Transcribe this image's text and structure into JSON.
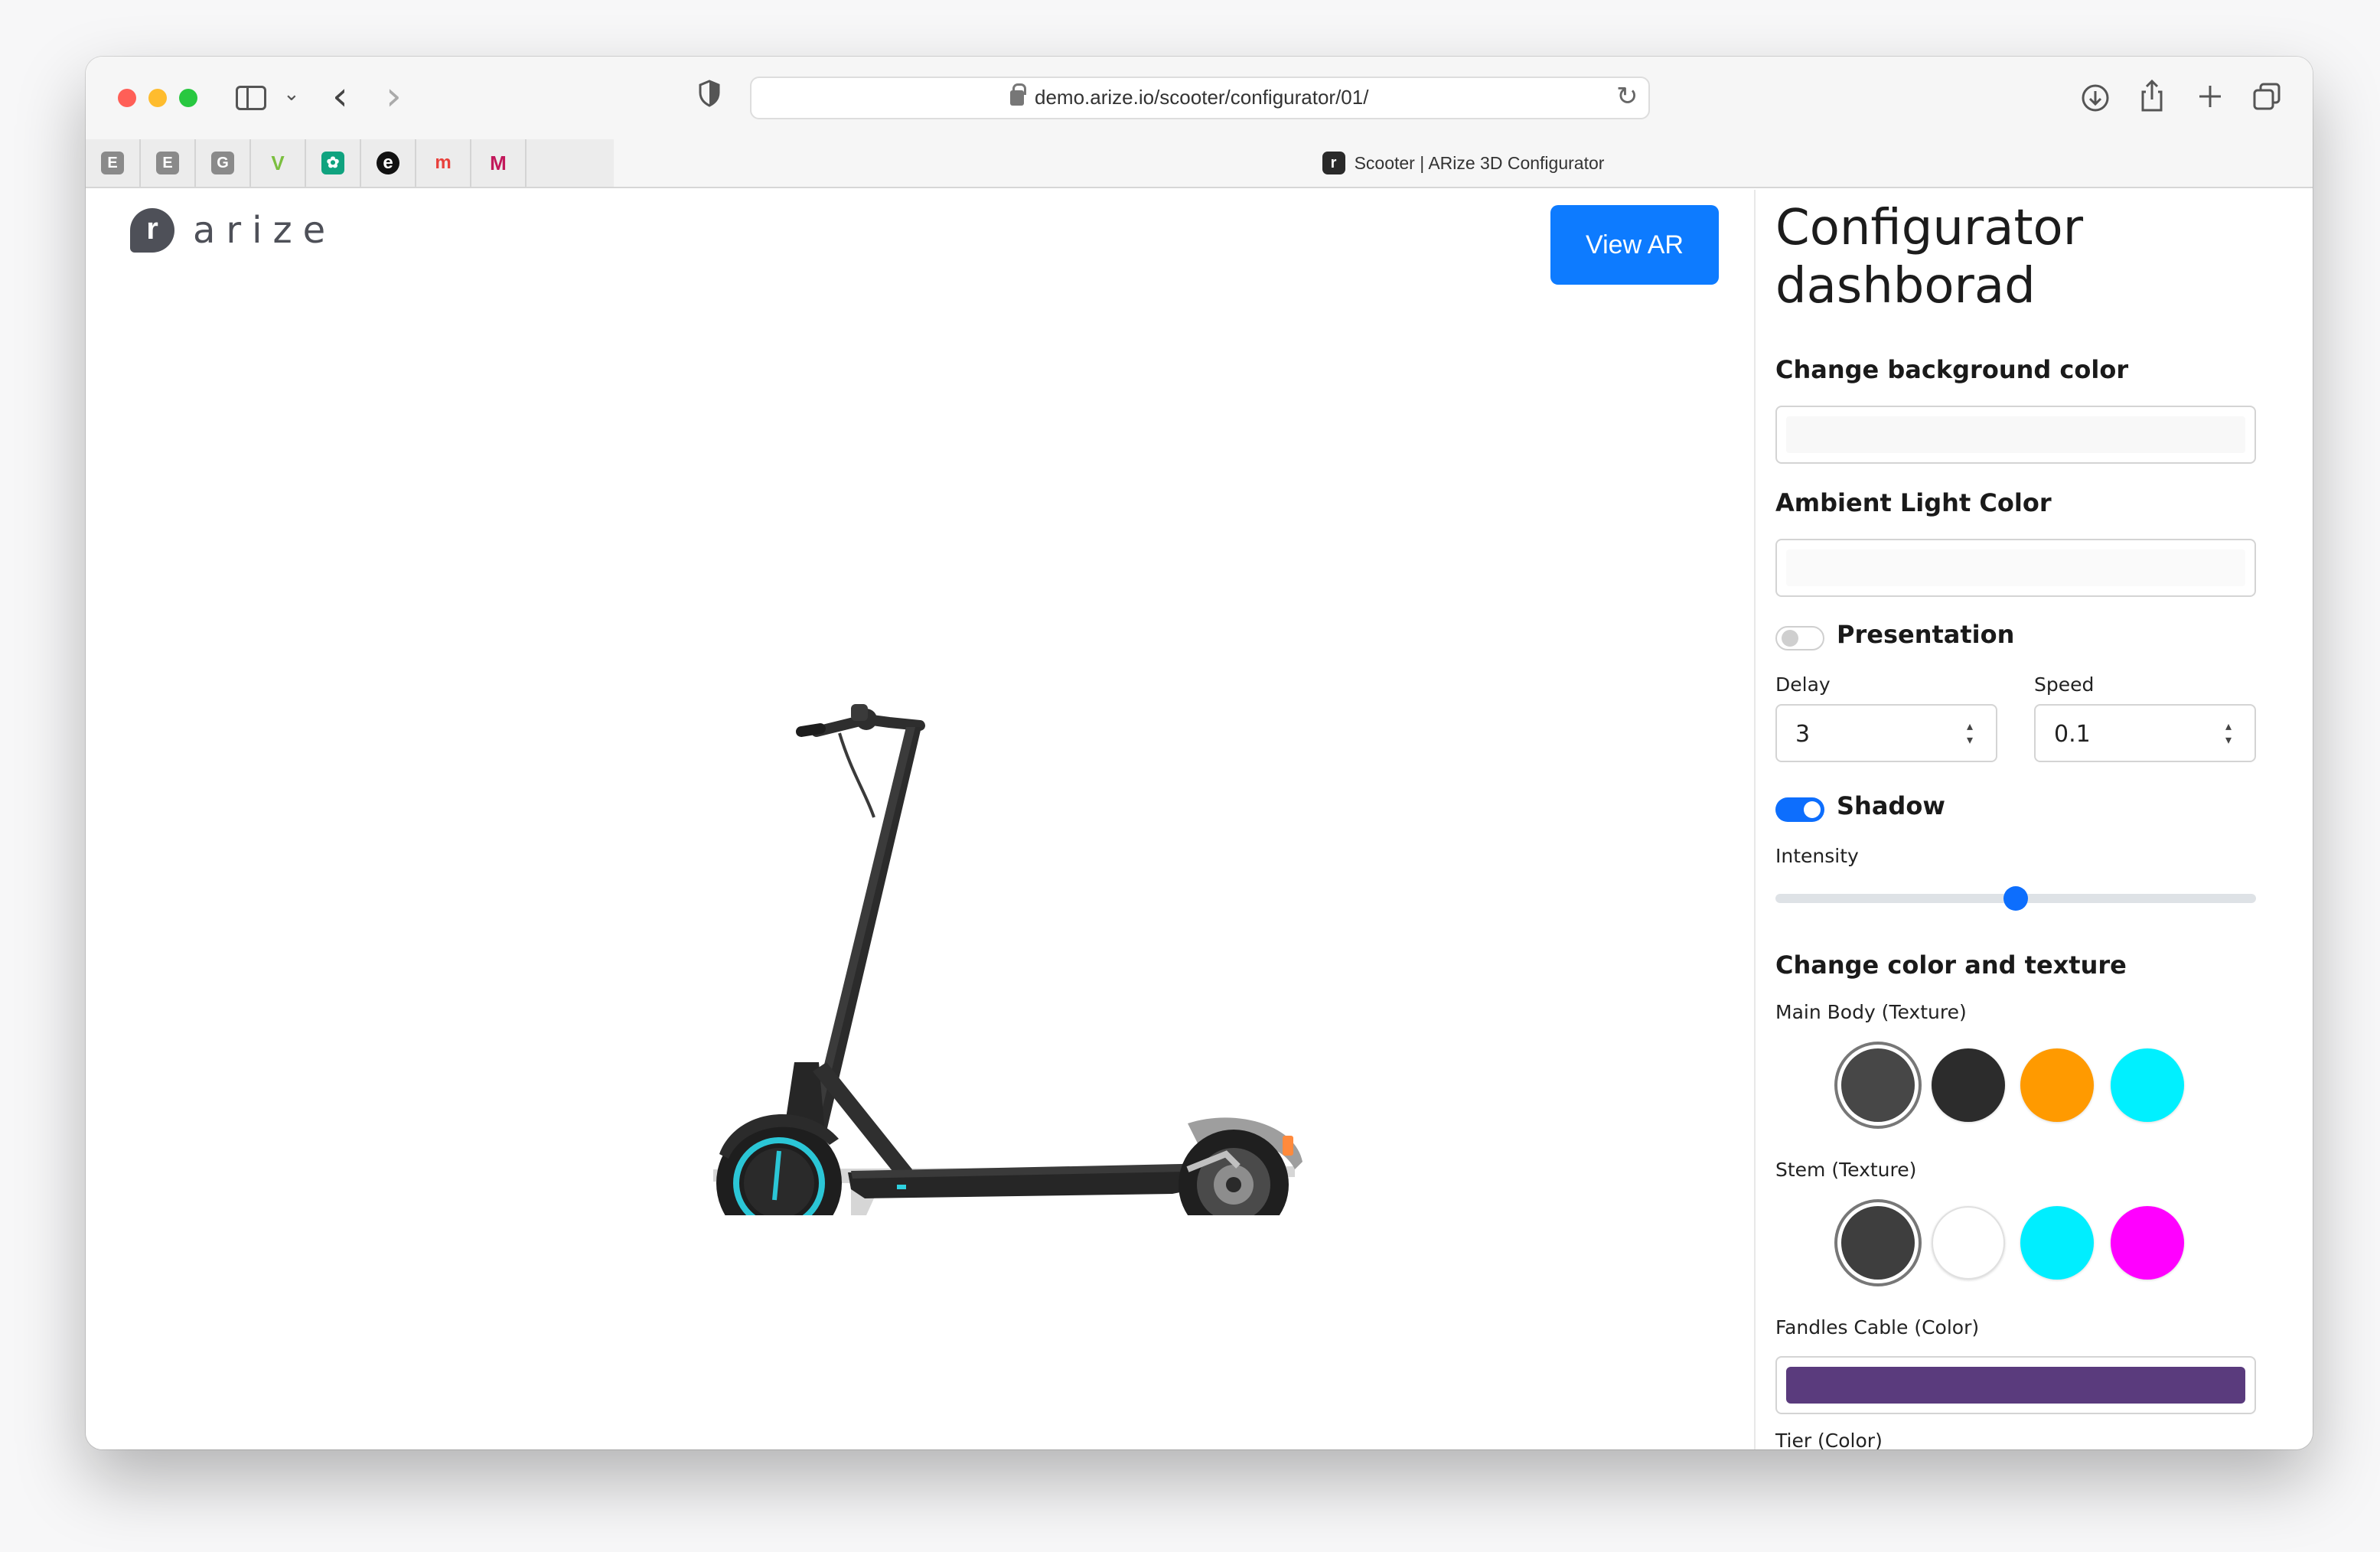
{
  "browser": {
    "url": "demo.arize.io/scooter/configurator/01/",
    "tab_title": "Scooter | ARize 3D Configurator",
    "tab_favicon_letter": "r",
    "pinned_tabs": [
      {
        "icon": "E",
        "color": "#8a8a8a"
      },
      {
        "icon": "E",
        "color": "#8a8a8a"
      },
      {
        "icon": "G",
        "color": "#8a8a8a"
      },
      {
        "icon": "V",
        "color": "#7bbf3f"
      },
      {
        "icon": "✿",
        "color": "#10a37f"
      },
      {
        "icon": "e",
        "color": "#111111"
      },
      {
        "icon": "m",
        "color": "#e8e8e8"
      },
      {
        "icon": "M",
        "color": "#e8e8e8"
      }
    ]
  },
  "app": {
    "logo_text": "arize",
    "logo_mark": "r",
    "view_ar_label": "View AR",
    "accent_color": "#0d7bff"
  },
  "dashboard": {
    "title": "Configurator dashborad",
    "bg_color_heading": "Change background color",
    "ambient_heading": "Ambient Light Color",
    "presentation": {
      "label": "Presentation",
      "enabled": false
    },
    "delay_label": "Delay",
    "delay_value": "3",
    "speed_label": "Speed",
    "speed_value": "0.1",
    "shadow": {
      "label": "Shadow",
      "enabled": true
    },
    "intensity_label": "Intensity",
    "intensity_value": 0.5,
    "color_texture_heading": "Change color and texture",
    "main_body": {
      "label": "Main Body (Texture)",
      "swatches": [
        "#474747",
        "#2c2c2c",
        "#ff9a00",
        "#00f0ff"
      ],
      "selected": 0
    },
    "stem": {
      "label": "Stem (Texture)",
      "swatches": [
        "#3e3e3e",
        "#ffffff",
        "#00eeff",
        "#ff00ff"
      ],
      "selected": 0
    },
    "handles_cable": {
      "label": "Fandles Cable (Color)",
      "color": "#5a3b7d"
    },
    "tier_label": "Tier (Color)"
  }
}
